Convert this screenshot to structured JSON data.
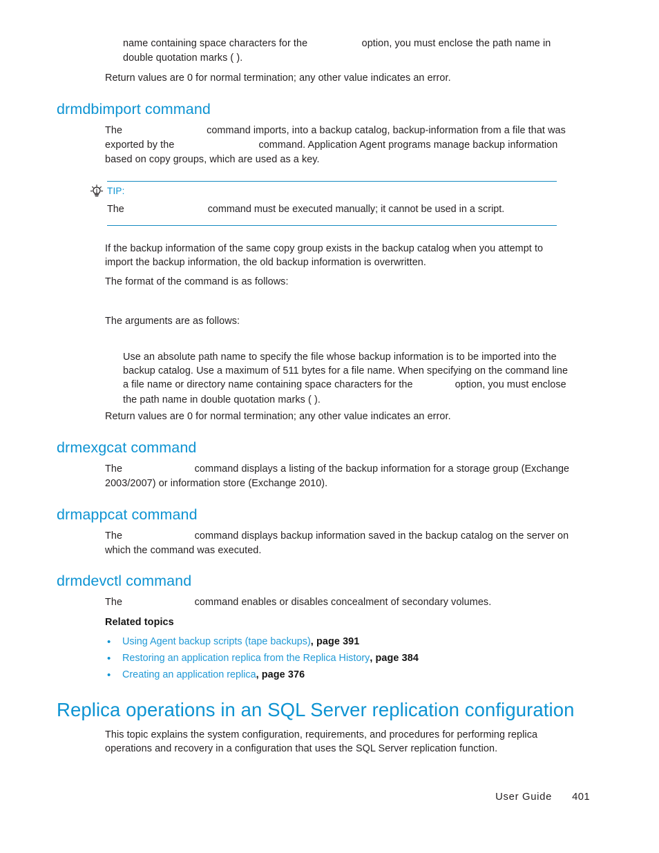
{
  "page": {
    "footer_label": "User Guide",
    "footer_page_number": "401"
  },
  "colors": {
    "heading_blue": "#0d93d2",
    "link_blue": "#2099d6",
    "rule_blue": "#1389c0",
    "body_text": "#231f20"
  },
  "blocks": {
    "intro_continuation": {
      "line_a": "name containing space characters for the",
      "line_b": "option, you must enclose the path name in double quotation marks (  )."
    },
    "return_values_1": "Return values are 0 for normal termination; any other value indicates an error.",
    "drmdbimport": {
      "heading": "drmdbimport command",
      "desc_a": "The",
      "desc_b": "command imports, into a backup catalog, backup-information from a file that was exported by the",
      "desc_c": "command. Application Agent programs manage backup information based on copy groups, which are used as a key."
    },
    "tip": {
      "icon": "lightbulb-icon",
      "label": "TIP:",
      "body_a": "The",
      "body_b": "command must be executed manually; it cannot be used in a script."
    },
    "overwrite_note": "If the backup information of the same copy group exists in the backup catalog when you attempt to import the backup information, the old backup information is overwritten.",
    "format_intro": "The format of the command is as follows:",
    "arguments_intro": "The arguments are as follows:",
    "argument_desc": {
      "line_1": "Use an absolute path name to specify the file whose backup information is to be imported into the backup catalog. Use a maximum of 511 bytes for a file name. When specifying on the command line a file name or directory name containing space characters for the",
      "line_2": "option, you must enclose the path name in double quotation marks (  )."
    },
    "return_values_2": "Return values are 0 for normal termination; any other value indicates an error.",
    "drmexgcat": {
      "heading": "drmexgcat command",
      "desc_a": "The",
      "desc_b": "command displays a listing of the backup information for a storage group (Exchange 2003/2007) or information store (Exchange 2010)."
    },
    "drmappcat": {
      "heading": "drmappcat command",
      "desc_a": "The",
      "desc_b": "command displays backup information saved in the backup catalog on the server on which the command was executed."
    },
    "drmdevctl": {
      "heading": "drmdevctl command",
      "desc_a": "The",
      "desc_b": "command enables or disables concealment of secondary volumes."
    },
    "related_topics": {
      "heading": "Related topics",
      "items": [
        {
          "link": "Using Agent backup scripts (tape backups)",
          "page": ", page 391"
        },
        {
          "link": "Restoring an application replica from the Replica History",
          "page": ", page 384"
        },
        {
          "link": "Creating an application replica",
          "page": ", page 376"
        }
      ]
    },
    "sql_section": {
      "heading": "Replica operations in an SQL Server replication configuration",
      "body": "This topic explains the system configuration, requirements, and procedures for performing replica operations and recovery in a configuration that uses the SQL Server replication function."
    }
  }
}
